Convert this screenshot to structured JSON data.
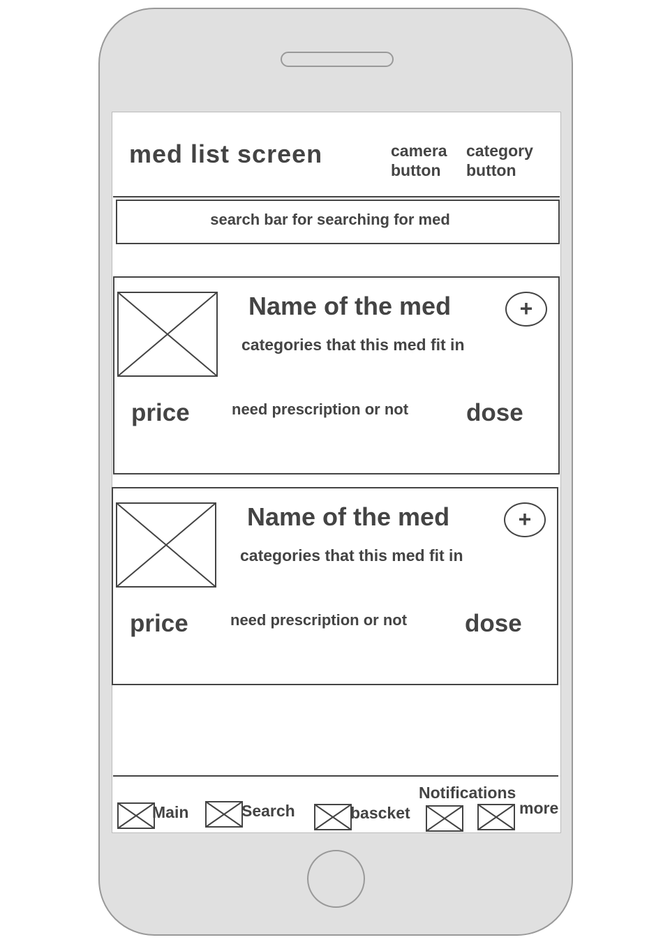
{
  "header": {
    "title": "med list screen",
    "camera_button": [
      "camera",
      "button"
    ],
    "category_button": [
      "category",
      "button"
    ]
  },
  "search": {
    "placeholder": "search bar for searching for med"
  },
  "meds": [
    {
      "name": "Name of the med",
      "categories": "categories that this med fit in",
      "price": "price",
      "prescription": "need prescription or not",
      "dose": "dose",
      "add_label": "+"
    },
    {
      "name": "Name of the med",
      "categories": "categories that this med fit in",
      "price": "price",
      "prescription": "need prescription or not",
      "dose": "dose",
      "add_label": "+"
    }
  ],
  "nav": {
    "main": "Main",
    "search": "Search",
    "basket": "bascket",
    "notifications": "Notifications",
    "more": "more"
  }
}
